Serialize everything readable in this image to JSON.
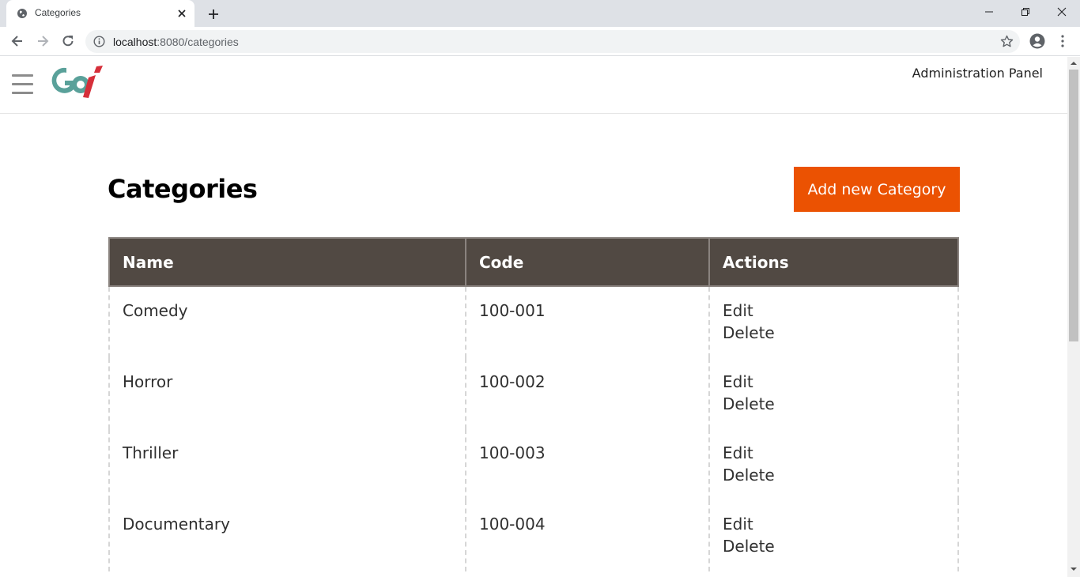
{
  "browser": {
    "tab_title": "Categories",
    "url_host": "localhost",
    "url_path": ":8080/categories"
  },
  "header": {
    "admin_label": "Administration Panel"
  },
  "page": {
    "title": "Categories",
    "add_button_label": "Add new Category"
  },
  "table": {
    "columns": [
      "Name",
      "Code",
      "Actions"
    ],
    "rows": [
      {
        "name": "Comedy",
        "code": "100-001",
        "actions": [
          "Edit",
          "Delete"
        ]
      },
      {
        "name": "Horror",
        "code": "100-002",
        "actions": [
          "Edit",
          "Delete"
        ]
      },
      {
        "name": "Thriller",
        "code": "100-003",
        "actions": [
          "Edit",
          "Delete"
        ]
      },
      {
        "name": "Documentary",
        "code": "100-004",
        "actions": [
          "Edit",
          "Delete"
        ]
      }
    ]
  },
  "colors": {
    "accent": "#eb5202",
    "table_header": "#514943",
    "logo_teal": "#5aa19a",
    "logo_red": "#d62f3a"
  }
}
